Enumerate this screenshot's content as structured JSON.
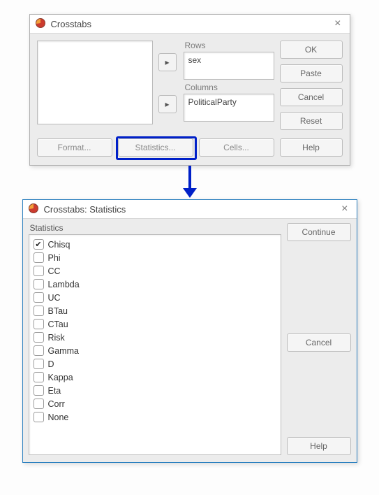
{
  "dialog1": {
    "title": "Crosstabs",
    "rows_label": "Rows",
    "rows_value": "sex",
    "columns_label": "Columns",
    "columns_value": "PoliticalParty",
    "buttons": {
      "ok": "OK",
      "paste": "Paste",
      "cancel": "Cancel",
      "reset": "Reset",
      "help": "Help",
      "format": "Format...",
      "statistics": "Statistics...",
      "cells": "Cells..."
    }
  },
  "dialog2": {
    "title": "Crosstabs: Statistics",
    "group_label": "Statistics",
    "items": [
      {
        "label": "Chisq",
        "checked": true
      },
      {
        "label": "Phi",
        "checked": false
      },
      {
        "label": "CC",
        "checked": false
      },
      {
        "label": "Lambda",
        "checked": false
      },
      {
        "label": "UC",
        "checked": false
      },
      {
        "label": "BTau",
        "checked": false
      },
      {
        "label": "CTau",
        "checked": false
      },
      {
        "label": "Risk",
        "checked": false
      },
      {
        "label": "Gamma",
        "checked": false
      },
      {
        "label": "D",
        "checked": false
      },
      {
        "label": "Kappa",
        "checked": false
      },
      {
        "label": "Eta",
        "checked": false
      },
      {
        "label": "Corr",
        "checked": false
      },
      {
        "label": "None",
        "checked": false
      }
    ],
    "buttons": {
      "continue": "Continue",
      "cancel": "Cancel",
      "help": "Help"
    }
  }
}
